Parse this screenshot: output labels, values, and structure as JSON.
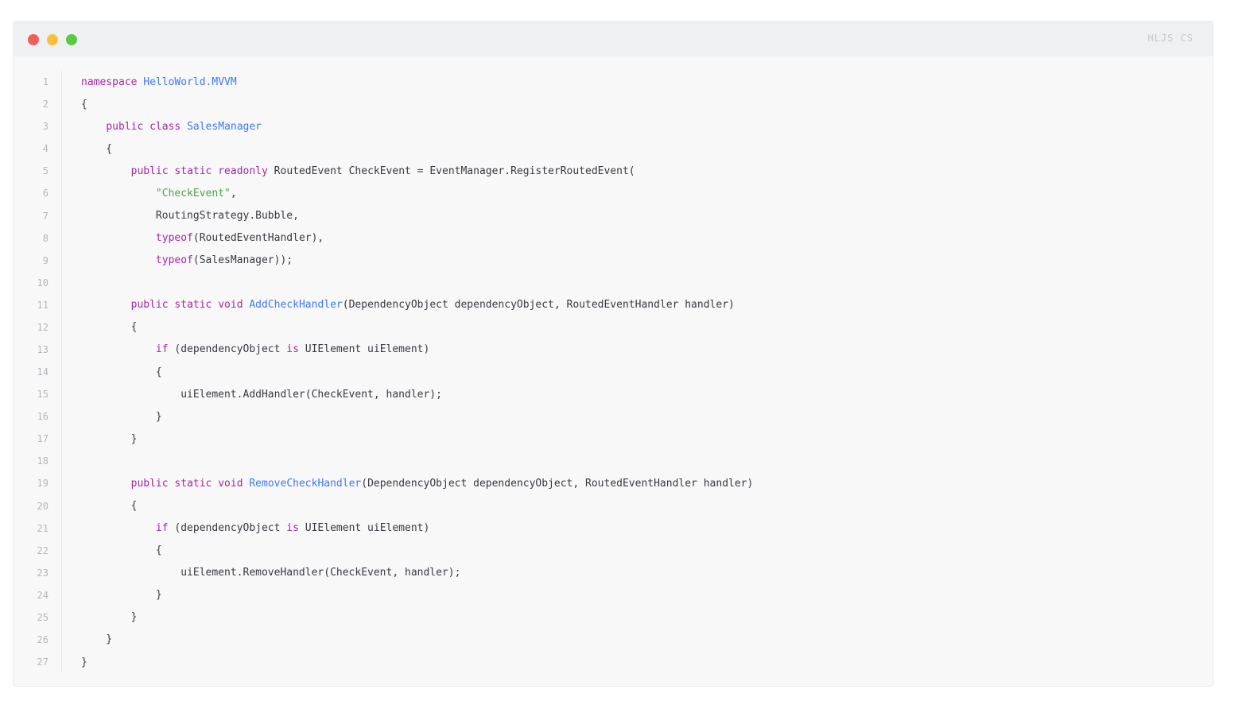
{
  "colors": {
    "dot_red": "#f25f58",
    "dot_yellow": "#fbbe3c",
    "dot_green": "#58cb42",
    "keyword": "#a626a4",
    "title": "#4078f2",
    "string": "#50a14f",
    "plain": "#383a42"
  },
  "window": {
    "language_label": "HLJS CS"
  },
  "code": {
    "lines": [
      [
        {
          "t": "keyword",
          "v": "namespace"
        },
        {
          "t": "plain",
          "v": " "
        },
        {
          "t": "title",
          "v": "HelloWorld.MVVM"
        }
      ],
      [
        {
          "t": "plain",
          "v": "{"
        }
      ],
      [
        {
          "t": "plain",
          "v": "    "
        },
        {
          "t": "keyword",
          "v": "public"
        },
        {
          "t": "plain",
          "v": " "
        },
        {
          "t": "keyword",
          "v": "class"
        },
        {
          "t": "plain",
          "v": " "
        },
        {
          "t": "title",
          "v": "SalesManager"
        }
      ],
      [
        {
          "t": "plain",
          "v": "    {"
        }
      ],
      [
        {
          "t": "plain",
          "v": "        "
        },
        {
          "t": "keyword",
          "v": "public"
        },
        {
          "t": "plain",
          "v": " "
        },
        {
          "t": "keyword",
          "v": "static"
        },
        {
          "t": "plain",
          "v": " "
        },
        {
          "t": "keyword",
          "v": "readonly"
        },
        {
          "t": "plain",
          "v": " RoutedEvent CheckEvent = EventManager.RegisterRoutedEvent("
        }
      ],
      [
        {
          "t": "plain",
          "v": "            "
        },
        {
          "t": "string",
          "v": "\"CheckEvent\""
        },
        {
          "t": "plain",
          "v": ","
        }
      ],
      [
        {
          "t": "plain",
          "v": "            RoutingStrategy.Bubble,"
        }
      ],
      [
        {
          "t": "plain",
          "v": "            "
        },
        {
          "t": "keyword",
          "v": "typeof"
        },
        {
          "t": "plain",
          "v": "(RoutedEventHandler),"
        }
      ],
      [
        {
          "t": "plain",
          "v": "            "
        },
        {
          "t": "keyword",
          "v": "typeof"
        },
        {
          "t": "plain",
          "v": "(SalesManager));"
        }
      ],
      [],
      [
        {
          "t": "plain",
          "v": "        "
        },
        {
          "t": "keyword",
          "v": "public"
        },
        {
          "t": "plain",
          "v": " "
        },
        {
          "t": "keyword",
          "v": "static"
        },
        {
          "t": "plain",
          "v": " "
        },
        {
          "t": "keyword",
          "v": "void"
        },
        {
          "t": "plain",
          "v": " "
        },
        {
          "t": "title",
          "v": "AddCheckHandler"
        },
        {
          "t": "plain",
          "v": "(DependencyObject dependencyObject, RoutedEventHandler handler)"
        }
      ],
      [
        {
          "t": "plain",
          "v": "        {"
        }
      ],
      [
        {
          "t": "plain",
          "v": "            "
        },
        {
          "t": "keyword",
          "v": "if"
        },
        {
          "t": "plain",
          "v": " (dependencyObject "
        },
        {
          "t": "keyword",
          "v": "is"
        },
        {
          "t": "plain",
          "v": " UIElement uiElement)"
        }
      ],
      [
        {
          "t": "plain",
          "v": "            {"
        }
      ],
      [
        {
          "t": "plain",
          "v": "                uiElement.AddHandler(CheckEvent, handler);"
        }
      ],
      [
        {
          "t": "plain",
          "v": "            }"
        }
      ],
      [
        {
          "t": "plain",
          "v": "        }"
        }
      ],
      [],
      [
        {
          "t": "plain",
          "v": "        "
        },
        {
          "t": "keyword",
          "v": "public"
        },
        {
          "t": "plain",
          "v": " "
        },
        {
          "t": "keyword",
          "v": "static"
        },
        {
          "t": "plain",
          "v": " "
        },
        {
          "t": "keyword",
          "v": "void"
        },
        {
          "t": "plain",
          "v": " "
        },
        {
          "t": "title",
          "v": "RemoveCheckHandler"
        },
        {
          "t": "plain",
          "v": "(DependencyObject dependencyObject, RoutedEventHandler handler)"
        }
      ],
      [
        {
          "t": "plain",
          "v": "        {"
        }
      ],
      [
        {
          "t": "plain",
          "v": "            "
        },
        {
          "t": "keyword",
          "v": "if"
        },
        {
          "t": "plain",
          "v": " (dependencyObject "
        },
        {
          "t": "keyword",
          "v": "is"
        },
        {
          "t": "plain",
          "v": " UIElement uiElement)"
        }
      ],
      [
        {
          "t": "plain",
          "v": "            {"
        }
      ],
      [
        {
          "t": "plain",
          "v": "                uiElement.RemoveHandler(CheckEvent, handler);"
        }
      ],
      [
        {
          "t": "plain",
          "v": "            }"
        }
      ],
      [
        {
          "t": "plain",
          "v": "        }"
        }
      ],
      [
        {
          "t": "plain",
          "v": "    }"
        }
      ],
      [
        {
          "t": "plain",
          "v": "}"
        }
      ]
    ]
  }
}
